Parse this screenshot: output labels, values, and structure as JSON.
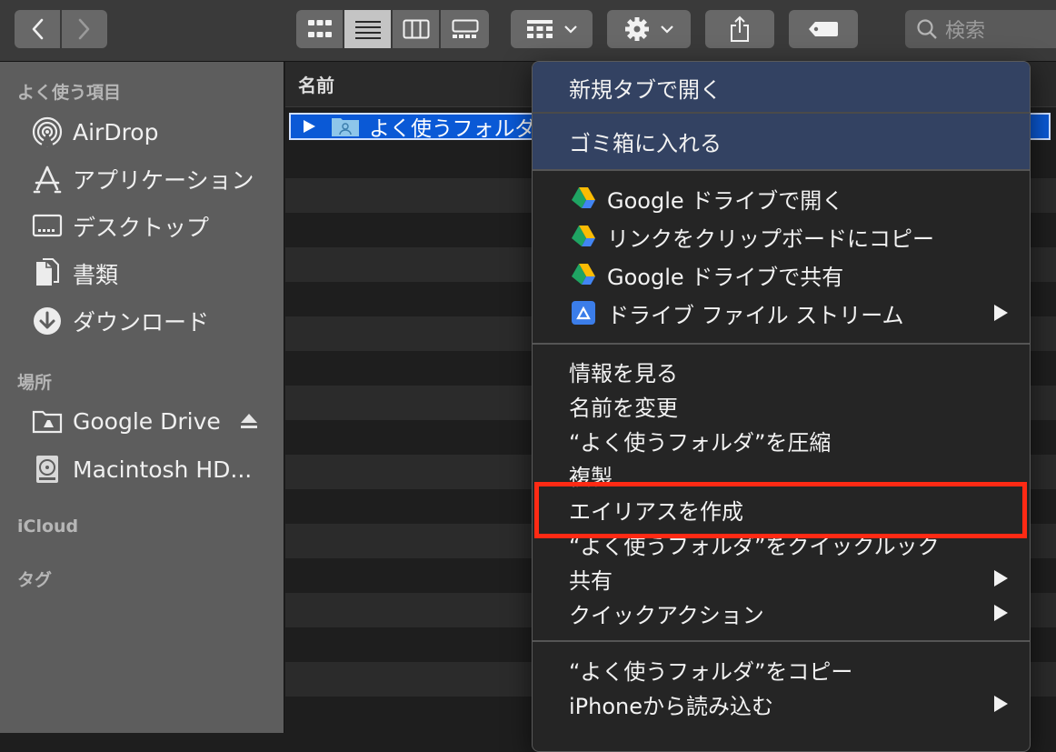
{
  "toolbar": {
    "search_placeholder": "検索",
    "icons": [
      "back-icon",
      "forward-icon",
      "icon-view-icon",
      "list-view-icon",
      "column-view-icon",
      "gallery-view-icon",
      "group-icon",
      "gear-icon",
      "share-icon",
      "tag-icon",
      "search-icon"
    ]
  },
  "sidebar": {
    "favorites_header": "よく使う項目",
    "favorites": [
      {
        "label": "AirDrop",
        "icon": "airdrop-icon"
      },
      {
        "label": "アプリケーション",
        "icon": "applications-icon"
      },
      {
        "label": "デスクトップ",
        "icon": "desktop-icon"
      },
      {
        "label": "書類",
        "icon": "documents-icon"
      },
      {
        "label": "ダウンロード",
        "icon": "downloads-icon"
      }
    ],
    "locations_header": "場所",
    "locations": [
      {
        "label": "Google Drive",
        "icon": "google-drive-folder-icon"
      },
      {
        "label": "Macintosh HD...",
        "icon": "hard-drive-icon"
      }
    ],
    "icloud_header": "iCloud",
    "tags_header": "タグ"
  },
  "filelist": {
    "column_name": "名前",
    "selected_item": "よく使うフォルダ"
  },
  "context_menu": {
    "groups": [
      [
        "新規タブで開く"
      ],
      [
        "ゴミ箱に入れる"
      ],
      [
        "Google ドライブで開く",
        "リンクをクリップボードにコピー",
        "Google ドライブで共有",
        "ドライブ ファイル ストリーム"
      ],
      [
        "情報を見る",
        "名前を変更",
        "“よく使うフォルダ”を圧縮",
        "複製",
        "エイリアスを作成",
        "“よく使うフォルダ”をクイックルック",
        "共有",
        "クイックアクション"
      ],
      [
        "“よく使うフォルダ”をコピー",
        "iPhoneから読み込む"
      ]
    ],
    "highlighted_item": "エイリアスを作成",
    "highlight_color": "#ff2a14"
  }
}
